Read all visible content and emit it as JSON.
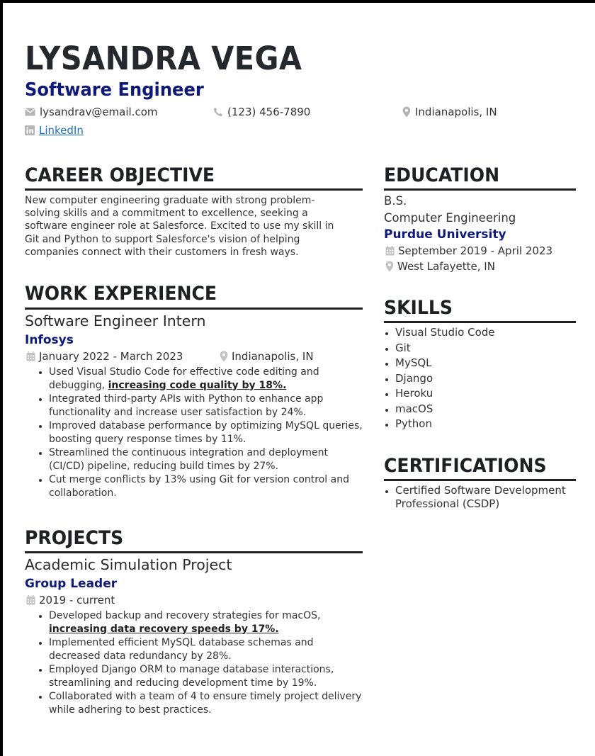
{
  "header": {
    "name": "LYSANDRA VEGA",
    "title": "Software Engineer",
    "email": "lysandrav@email.com",
    "phone": "(123) 456-7890",
    "location": "Indianapolis, IN",
    "linkedin": "LinkedIn"
  },
  "objective": {
    "heading": "CAREER OBJECTIVE",
    "lines": [
      "New computer engineering graduate with strong problem-",
      "solving skills and a commitment to excellence, seeking a",
      "software engineer role at Salesforce. Excited to use my skill in",
      "Git and Python to support Salesforce's vision of helping",
      "companies connect with their customers in fresh ways."
    ]
  },
  "work": {
    "heading": "WORK EXPERIENCE",
    "role": "Software Engineer Intern",
    "company": "Infosys",
    "dates": "January 2022 - March 2023",
    "location": "Indianapolis, IN",
    "bullets": [
      {
        "pre": "Used Visual Studio Code for effective code editing and debugging, ",
        "hl": "increasing code quality by 18%."
      },
      {
        "pre": "Integrated third-party APIs with Python to enhance app functionality and increase user satisfaction by 24%.",
        "hl": ""
      },
      {
        "pre": "Improved database performance by optimizing MySQL queries, boosting query response times by 11%.",
        "hl": ""
      },
      {
        "pre": "Streamlined the continuous integration and deployment (CI/CD) pipeline, reducing build times by 27%.",
        "hl": ""
      },
      {
        "pre": "Cut merge conflicts by 13% using Git for version control and collaboration.",
        "hl": ""
      }
    ]
  },
  "projects": {
    "heading": "PROJECTS",
    "name": "Academic Simulation Project",
    "role": "Group Leader",
    "dates": "2019 - current",
    "bullets": [
      {
        "pre": "Developed backup and recovery strategies for macOS, ",
        "hl": "increasing data recovery speeds by 17%."
      },
      {
        "pre": "Implemented efficient MySQL database schemas and decreased data redundancy by 28%.",
        "hl": ""
      },
      {
        "pre": "Employed Django ORM to manage database interactions, streamlining and reducing development time by 19%.",
        "hl": ""
      },
      {
        "pre": "Collaborated with a team of 4 to ensure timely project delivery while adhering to best practices.",
        "hl": ""
      }
    ]
  },
  "education": {
    "heading": "EDUCATION",
    "degree": "B.S.",
    "major": "Computer Engineering",
    "school": "Purdue University",
    "dates": "September 2019 - April 2023",
    "location": "West Lafayette, IN"
  },
  "skills": {
    "heading": "SKILLS",
    "items": [
      "Visual Studio Code",
      "Git",
      "MySQL",
      "Django",
      "Heroku",
      "macOS",
      "Python"
    ]
  },
  "certifications": {
    "heading": "CERTIFICATIONS",
    "items": [
      "Certified Software Development Professional (CSDP)"
    ]
  },
  "colors": {
    "accent": "#0f1a78",
    "heading": "#1e2024",
    "link": "#1a73c9",
    "icon": "#b5b5b5"
  },
  "icons": [
    "envelope-icon",
    "phone-icon",
    "map-pin-icon",
    "linkedin-icon",
    "calendar-icon"
  ]
}
